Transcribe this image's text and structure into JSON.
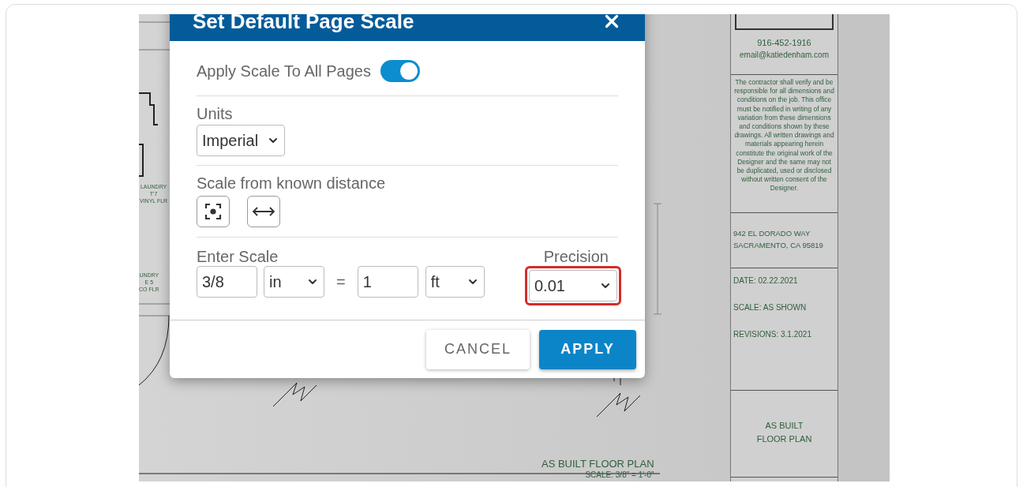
{
  "dialog": {
    "title": "Set Default Page Scale",
    "toggle": {
      "label": "Apply Scale To All Pages",
      "on": true
    },
    "units": {
      "label": "Units",
      "value": "Imperial"
    },
    "known_distance": {
      "label": "Scale from known distance",
      "tools": [
        {
          "kind": "area"
        },
        {
          "kind": "distance"
        }
      ]
    },
    "scale": {
      "label": "Enter Scale",
      "page_value": "3/8",
      "page_unit": "in",
      "equals": "=",
      "real_value": "1",
      "real_unit": "ft"
    },
    "precision": {
      "label": "Precision",
      "value": "0.01",
      "highlighted": true
    },
    "buttons": [
      {
        "label": "CANCEL",
        "kind": "secondary"
      },
      {
        "label": "APPLY",
        "kind": "primary"
      }
    ]
  },
  "drawing": {
    "room_labels": [
      {
        "lines": [
          "LAUNDRY",
          "T'7",
          "VINYL FLR"
        ]
      },
      {
        "lines": [
          "UNDRY",
          "E 5",
          "CO FLR"
        ]
      }
    ],
    "plan_title": "AS BUILT FLOOR PLAN",
    "plan_scale": "SCALE: 3/8\" = 1'-0\"",
    "title_block": {
      "phone": "916-452-1916",
      "email": "email@katiedenham.com",
      "notice": "The contractor shall  verify and be responsible for all dimensions and conditions on the job. This office must be notified in writing of any variation from these dimensions and conditions shown by these drawings. All written drawings and materials appearing herein constitute the original work of the Designer and the same may not be duplicated, used or disclosed without written consent of the Designer.",
      "address": [
        "942 EL DORADO WAY",
        "SACRAMENTO, CA 95819"
      ],
      "info": [
        "DATE: 02.22.2021",
        "SCALE: AS SHOWN",
        "REVISIONS: 3.1.2021"
      ],
      "sheet_title": [
        "AS BUILT",
        "FLOOR PLAN"
      ]
    }
  }
}
